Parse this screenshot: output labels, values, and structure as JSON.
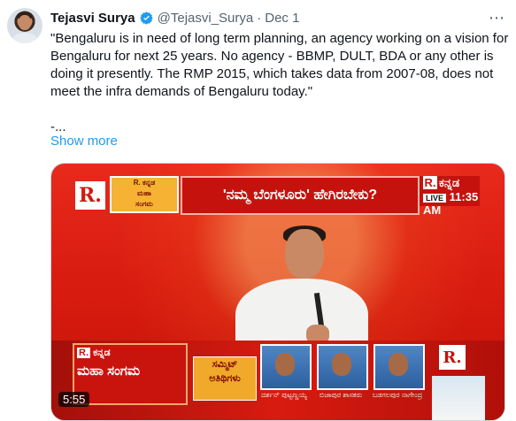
{
  "author": {
    "name": "Tejasvi Surya",
    "handle": "@Tejasvi_Surya",
    "separator": "·",
    "date": "Dec 1"
  },
  "tweet": {
    "text": "\"Bengaluru is in need of long term planning, an agency working on a vision for Bengaluru for next 25 years. No agency - BBMP, DULT, BDA or any other is doing it presently. The RMP 2015, which takes data from 2007-08, does not meet the infra demands of Bengaluru today.\"\n\n-...",
    "show_more": "Show more"
  },
  "media": {
    "logo": "R.",
    "badge_lines": [
      "R. ಕನ್ನಡ",
      "ಮಹಾ",
      "ಸಂಗಮ"
    ],
    "headline": "'ನಮ್ಮ ಬೆಂಗಳೂರು' ಹೇಗಿರಬೇಕು?",
    "channel_name": "ಕನ್ನಡ",
    "live_label": "LIVE",
    "time": "11:35 AM",
    "promo_title": "ಮಹಾ ಸಂಗಮ",
    "summit_text": [
      "ಸಮ್ಮಿಟ್",
      "ಅತಿಥಿಗಳು"
    ],
    "captions": [
      "ದರ್ಶನ್ ಪುಟ್ಟಣ್ಣಯ್ಯ",
      "ಬಿಜಾಪುರ ಶಾಸಕರು",
      "ಬಡಗಲಪುರ ನಾಗೇಂದ್ರ"
    ],
    "duration": "5:55"
  },
  "icons": {
    "verified": "verified-badge-icon",
    "more": "more-options-icon"
  },
  "colors": {
    "link": "#1d9bf0",
    "text": "#0f1419",
    "secondary": "#536471"
  }
}
